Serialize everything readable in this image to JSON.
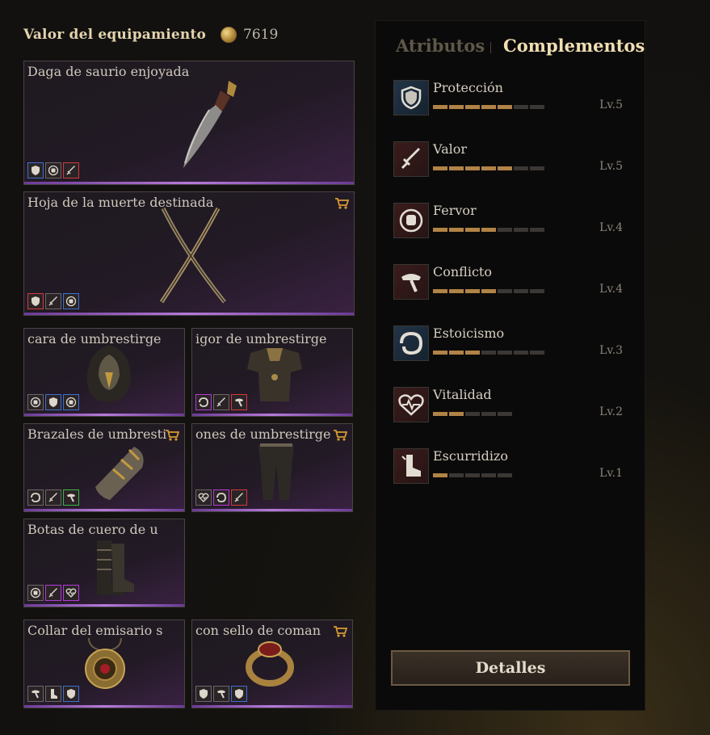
{
  "header": {
    "title": "Valor del equipamiento",
    "coin_icon": "gold-coin-icon",
    "value": "7619"
  },
  "equipment": [
    {
      "title": "Daga de saurio enjoyada",
      "cart": false,
      "mods": [
        {
          "icon": "shield-icon",
          "border": "blue"
        },
        {
          "icon": "fist-icon",
          "border": "grey"
        },
        {
          "icon": "sword-icon",
          "border": "red"
        }
      ]
    },
    {
      "title": "Hoja de la muerte destinada",
      "cart": true,
      "mods": [
        {
          "icon": "shield-icon",
          "border": "red"
        },
        {
          "icon": "sword-icon",
          "border": "grey"
        },
        {
          "icon": "fist-icon",
          "border": "blue"
        }
      ]
    },
    {
      "title": "cara de umbrestirge",
      "cart": false,
      "mods": [
        {
          "icon": "fist-icon",
          "border": "grey"
        },
        {
          "icon": "shield-icon",
          "border": "blue"
        },
        {
          "icon": "fist-icon",
          "border": "blue"
        }
      ]
    },
    {
      "title": "igor de umbrestirge",
      "cart": false,
      "mods": [
        {
          "icon": "stoic-icon",
          "border": "purple"
        },
        {
          "icon": "sword-icon",
          "border": "grey"
        },
        {
          "icon": "hammer-icon",
          "border": "red"
        }
      ]
    },
    {
      "title": "Brazales de umbresti",
      "cart": true,
      "mods": [
        {
          "icon": "stoic-icon",
          "border": "grey"
        },
        {
          "icon": "sword-icon",
          "border": "grey"
        },
        {
          "icon": "hammer-icon",
          "border": "green"
        }
      ]
    },
    {
      "title": "ones de umbrestirge",
      "cart": true,
      "mods": [
        {
          "icon": "heart-icon",
          "border": "grey"
        },
        {
          "icon": "stoic-icon",
          "border": "purple"
        },
        {
          "icon": "sword-icon",
          "border": "red"
        }
      ]
    },
    {
      "title": "Botas de cuero de u",
      "cart": false,
      "mods": [
        {
          "icon": "fist-icon",
          "border": "grey"
        },
        {
          "icon": "sword-icon",
          "border": "purple"
        },
        {
          "icon": "heart-icon",
          "border": "purple"
        }
      ]
    },
    {
      "title": "Collar del emisario s",
      "cart": false,
      "mods": [
        {
          "icon": "hammer-icon",
          "border": "grey"
        },
        {
          "icon": "boot-icon",
          "border": "grey"
        },
        {
          "icon": "shield-icon",
          "border": "blue"
        }
      ]
    },
    {
      "title": "con sello de coman",
      "cart": true,
      "mods": [
        {
          "icon": "shield-icon",
          "border": "grey"
        },
        {
          "icon": "hammer-icon",
          "border": "grey"
        },
        {
          "icon": "shield-icon",
          "border": "blue"
        }
      ]
    }
  ],
  "panel": {
    "tabs": [
      "Atributos",
      "Complementos"
    ],
    "active_tab": "Complementos",
    "attributes": [
      {
        "name": "Protección",
        "level": "Lv.5",
        "filled": 5,
        "total": 7,
        "icon": "shield-icon",
        "tint": "bl"
      },
      {
        "name": "Valor",
        "level": "Lv.5",
        "filled": 5,
        "total": 7,
        "icon": "sword-icon",
        "tint": "rd"
      },
      {
        "name": "Fervor",
        "level": "Lv.4",
        "filled": 4,
        "total": 7,
        "icon": "fist-icon",
        "tint": "rd"
      },
      {
        "name": "Conflicto",
        "level": "Lv.4",
        "filled": 4,
        "total": 7,
        "icon": "hammer-icon",
        "tint": "rd"
      },
      {
        "name": "Estoicismo",
        "level": "Lv.3",
        "filled": 3,
        "total": 7,
        "icon": "stoic-icon",
        "tint": "bl"
      },
      {
        "name": "Vitalidad",
        "level": "Lv.2",
        "filled": 2,
        "total": 5,
        "icon": "heart-icon",
        "tint": "rd"
      },
      {
        "name": "Escurridizo",
        "level": "Lv.1",
        "filled": 1,
        "total": 5,
        "icon": "boot-icon",
        "tint": "rd"
      }
    ],
    "details_button": "Detalles"
  }
}
